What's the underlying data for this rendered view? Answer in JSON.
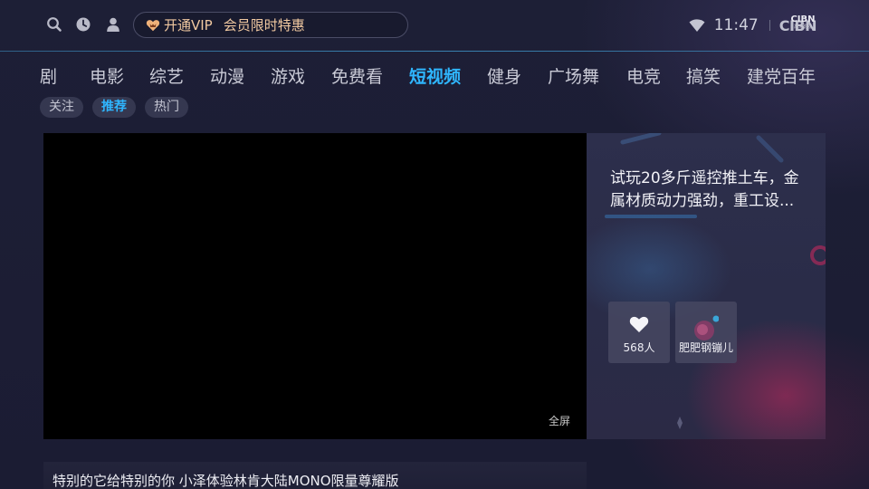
{
  "topbar": {
    "icons": [
      "search-icon",
      "history-clock-icon",
      "user-icon"
    ],
    "vip": {
      "icon": "vip-heart-badge-icon",
      "label": "开通VIP",
      "promo": "会员限时特惠",
      "color": "#f0c8a0"
    },
    "status": {
      "wifi_icon": "wifi-icon",
      "time": "11:47",
      "cibn_logo": "CIBN",
      "brand_logo_main": "CIBN",
      "brand_logo_sub": "高清影视"
    }
  },
  "nav": {
    "items": [
      {
        "label": "剧"
      },
      {
        "label": "电影"
      },
      {
        "label": "综艺"
      },
      {
        "label": "动漫"
      },
      {
        "label": "游戏"
      },
      {
        "label": "免费看"
      },
      {
        "label": "短视频",
        "active": true
      },
      {
        "label": "健身"
      },
      {
        "label": "广场舞"
      },
      {
        "label": "电竞"
      },
      {
        "label": "搞笑"
      },
      {
        "label": "建党百年"
      }
    ],
    "active_color": "#2fb6ff"
  },
  "subtabs": [
    {
      "label": "关注"
    },
    {
      "label": "推荐",
      "active": true
    },
    {
      "label": "热门"
    }
  ],
  "player": {
    "fullscreen_label": "全屏"
  },
  "info": {
    "title": "试玩20多斤遥控推土车，金属材质动力强劲，重工设...",
    "like_count": "568人",
    "like_icon": "heart-icon",
    "author_name": "肥肥钢镚儿",
    "author_icon": "author-avatar"
  },
  "bottom": {
    "caption": "特别的它给特别的你 小泽体验林肯大陆MONO限量尊耀版"
  }
}
